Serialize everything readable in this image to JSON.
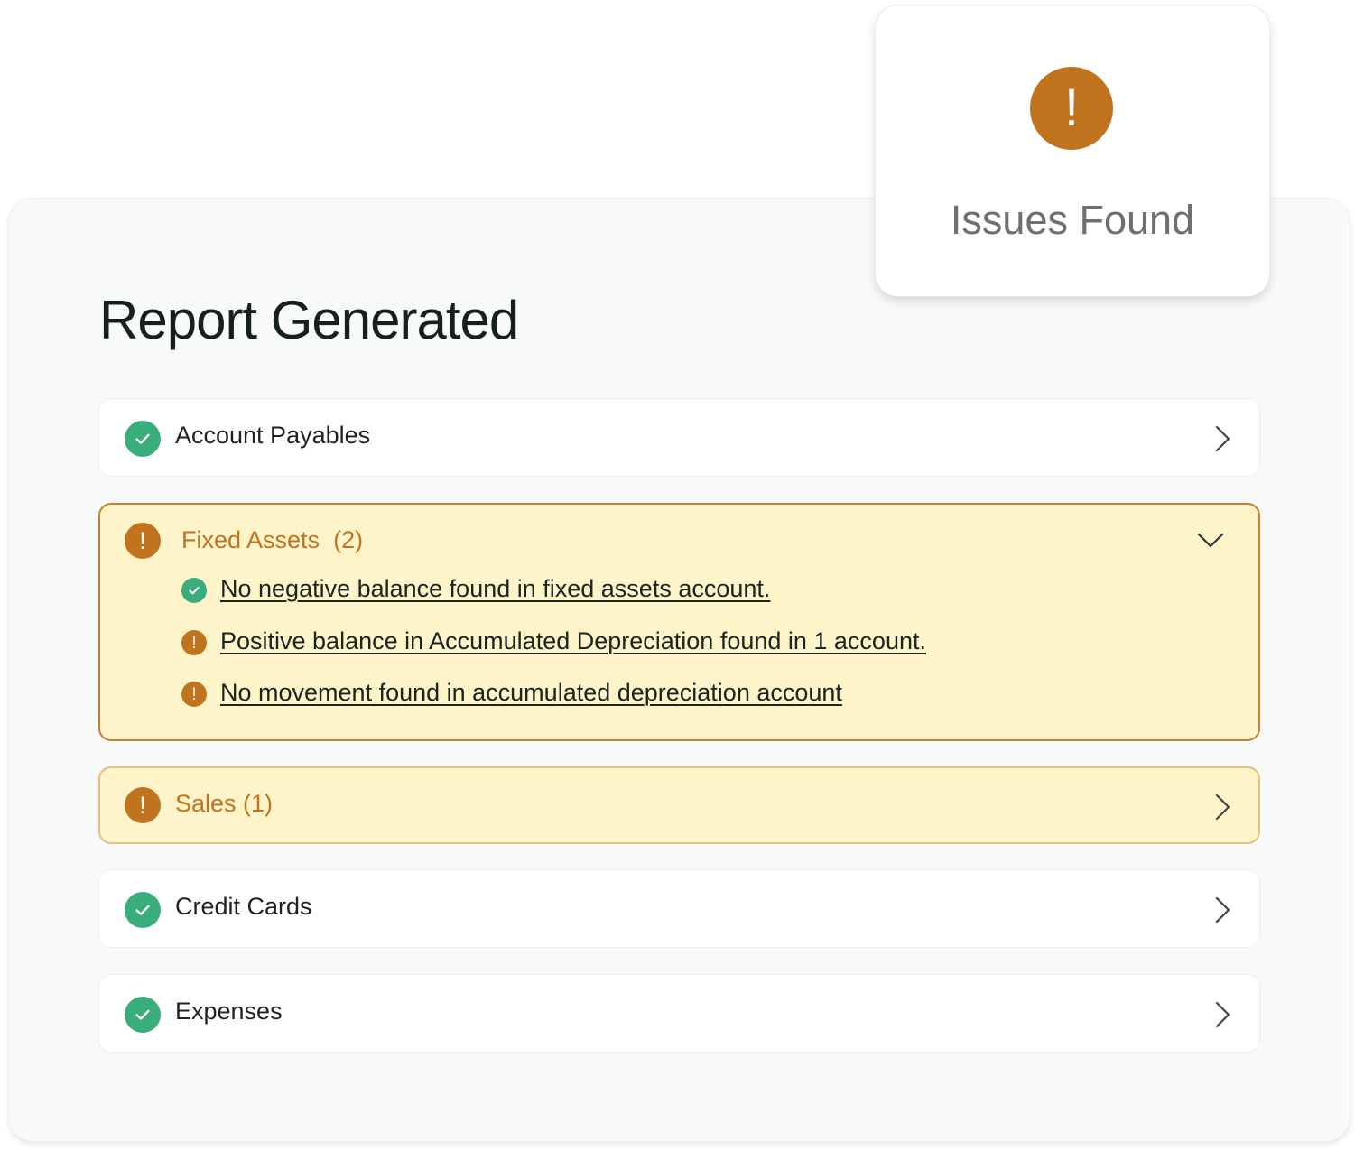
{
  "page": {
    "title": "Report Generated"
  },
  "popup": {
    "alert_glyph": "!",
    "status": "Issues Found"
  },
  "colors": {
    "ok_green": "#3aad7c",
    "warn_orange": "#c2731d",
    "warn_background": "#fdf4c9",
    "text_dark": "#1c2421"
  },
  "sections": [
    {
      "label": "Account Payables",
      "count": "",
      "status": "ok",
      "icon": "check-circle-icon",
      "chevron": "chevron-right-icon"
    },
    {
      "label": "Fixed Assets",
      "count": "(2)",
      "status": "warning",
      "icon": "alert-circle-icon",
      "chevron": "chevron-down-icon",
      "expanded": true,
      "alert_glyph": "!",
      "checks": [
        {
          "text": "No negative balance found in fixed assets account.",
          "status": "ok",
          "icon": "check-circle-icon"
        },
        {
          "text": "Positive balance in Accumulated Depreciation found in 1 account.",
          "status": "warning",
          "icon": "alert-circle-icon",
          "glyph": "!"
        },
        {
          "text": "No movement found in accumulated depreciation account",
          "status": "warning",
          "icon": "alert-circle-icon",
          "glyph": "!"
        }
      ]
    },
    {
      "label": "Sales (1)",
      "status": "warning",
      "icon": "alert-circle-icon",
      "chevron": "chevron-right-icon",
      "alert_glyph": "!"
    },
    {
      "label": "Credit Cards",
      "status": "ok",
      "icon": "check-circle-icon",
      "chevron": "chevron-right-icon"
    },
    {
      "label": "Expenses",
      "status": "ok",
      "icon": "check-circle-icon",
      "chevron": "chevron-right-icon"
    }
  ]
}
